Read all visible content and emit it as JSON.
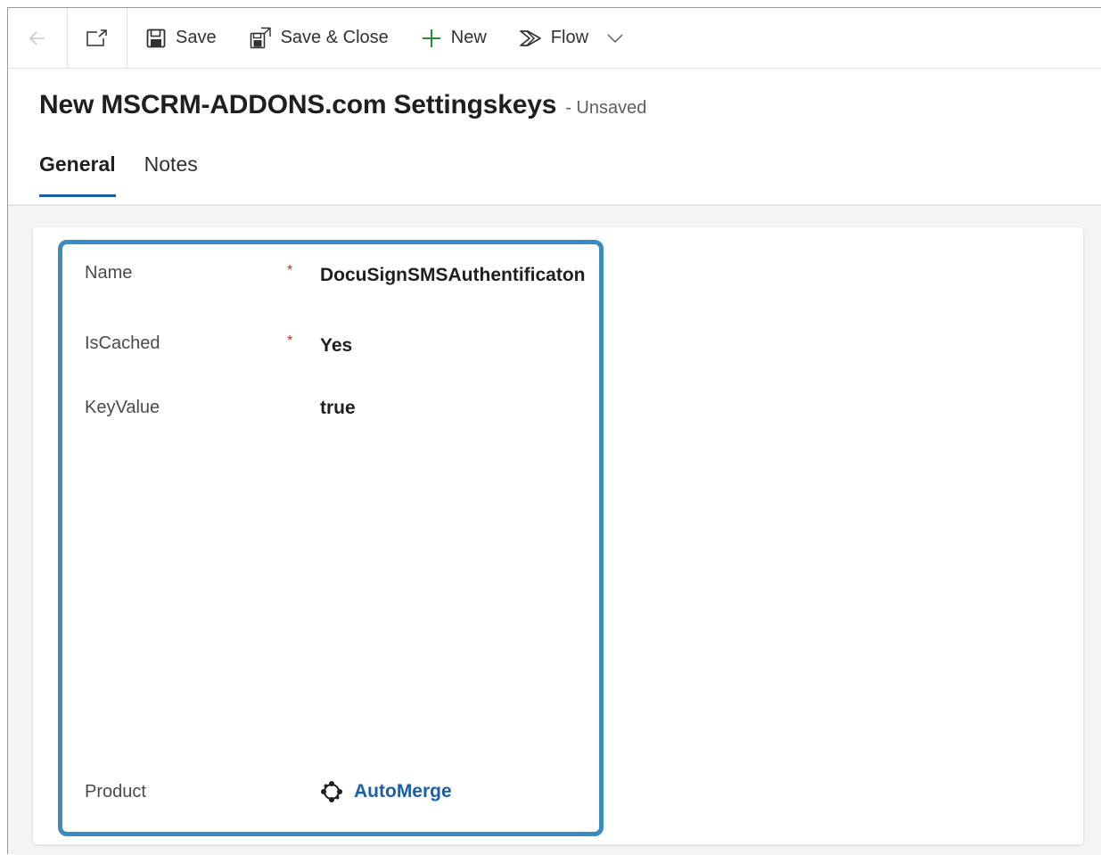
{
  "toolbar": {
    "save_label": "Save",
    "save_close_label": "Save & Close",
    "new_label": "New",
    "flow_label": "Flow"
  },
  "header": {
    "title": "New MSCRM-ADDONS.com Settingskeys",
    "status": "- Unsaved"
  },
  "tabs": [
    {
      "label": "General",
      "active": true
    },
    {
      "label": "Notes",
      "active": false
    }
  ],
  "form": {
    "fields": [
      {
        "label": "Name",
        "required": "*",
        "value": "DocuSignSMSAuthentificaton"
      },
      {
        "label": "IsCached",
        "required": "*",
        "value": "Yes"
      },
      {
        "label": "KeyValue",
        "required": "",
        "value": "true"
      },
      {
        "label": "Product",
        "required": "",
        "value": "AutoMerge"
      }
    ]
  },
  "colors": {
    "accent": "#1c5fa8",
    "highlight_border": "#3d8bbd",
    "required": "#c4262e"
  },
  "icons": [
    "back-arrow-icon",
    "open-in-new-window-icon",
    "save-icon",
    "save-close-icon",
    "plus-icon",
    "flow-icon",
    "chevron-down-icon",
    "product-entity-icon"
  ]
}
